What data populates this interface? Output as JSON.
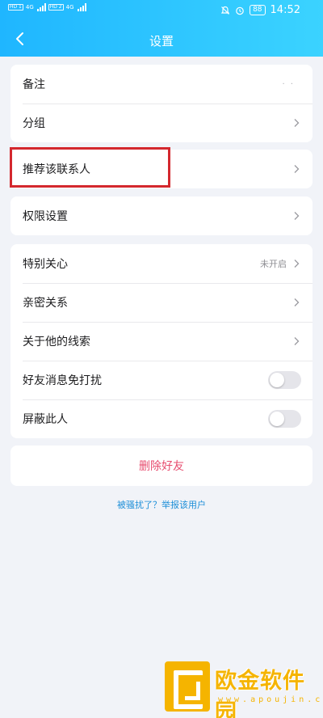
{
  "status_bar": {
    "sim1": "HD 1",
    "sim2": "HD 2",
    "network": "4G",
    "network2": "4G",
    "battery": "88",
    "time": "14:52"
  },
  "nav": {
    "title": "设置",
    "back_icon": "chevron-left-icon"
  },
  "sections": {
    "remark": {
      "label": "备注",
      "value": "· ·"
    },
    "group": {
      "label": "分组"
    },
    "recommend": {
      "label": "推荐该联系人"
    },
    "permission": {
      "label": "权限设置"
    },
    "special_care": {
      "label": "特别关心",
      "value": "未开启"
    },
    "intimacy": {
      "label": "亲密关系"
    },
    "clues": {
      "label": "关于他的线索"
    },
    "mute": {
      "label": "好友消息免打扰",
      "enabled": false
    },
    "block": {
      "label": "屏蔽此人",
      "enabled": false
    }
  },
  "delete_button": {
    "label": "删除好友"
  },
  "report_link": {
    "label": "被骚扰了？举报该用户"
  },
  "watermark": {
    "title": "欧金软件园",
    "url": "www.apoujin.com"
  },
  "colors": {
    "header_start": "#1fb6ff",
    "header_end": "#3bd3ff",
    "danger": "#e74d6f",
    "link": "#1e8fd8",
    "highlight": "#d4282e",
    "watermark": "#f5b400"
  }
}
